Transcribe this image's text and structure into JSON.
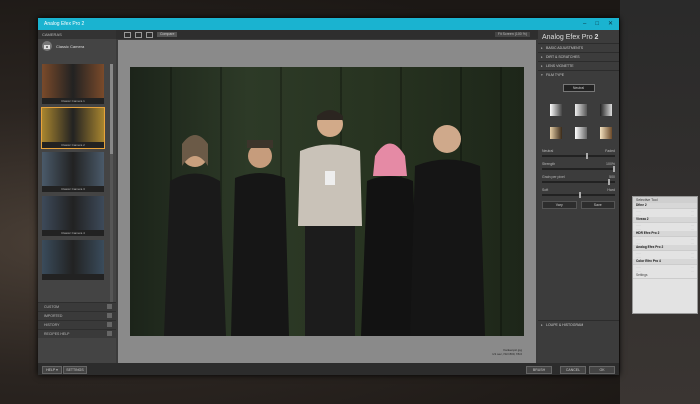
{
  "window": {
    "title": "Analog Efex Pro 2",
    "controls": [
      "–",
      "□",
      "✕"
    ]
  },
  "left_panel": {
    "header": "CAMERAS",
    "category": "Classic Camera",
    "thumbs": [
      {
        "caption": "Classic Camera 1",
        "tint": "#7a4a2a"
      },
      {
        "caption": "Classic Camera 2",
        "tint": "#a8852f"
      },
      {
        "caption": "Classic Camera 3",
        "tint": "#4a5a6a"
      },
      {
        "caption": "Classic Camera 4",
        "tint": "#3d4a5a"
      },
      {
        "caption": "",
        "tint": "#3a4c5c"
      }
    ],
    "sections": [
      "CUSTOM",
      "IMPORTED",
      "HISTORY",
      "RECIPES HELP"
    ]
  },
  "toolbar": {
    "compare": "Compare",
    "zoom": "Fit Screen (100 %)"
  },
  "canvas": {
    "caption_line1": "frankenpic.jpg",
    "caption_line2": "1/1 sec, ISO 800, f/8.0"
  },
  "right_panel": {
    "title_prefix": "Analog Efex Pro ",
    "title_num": "2",
    "sections": [
      "BASIC ADJUSTMENTS",
      "DIRT & SCRATCHES",
      "LENS VIGNETTE",
      "FILM TYPE"
    ],
    "preset": "Neutral",
    "slider_labels": {
      "neutral": "Neutral",
      "faded": "Faded",
      "strength": "Strength",
      "strength_val": "100%",
      "grain": "Grain per pixel",
      "grain_val": "500",
      "soft": "Soft",
      "hard": "Hard"
    },
    "buttons": [
      "Vary",
      "Save"
    ],
    "bottom_section": "LOUPE & HISTOGRAM"
  },
  "bottom_bar": {
    "help": "HELP ▾",
    "settings": "SETTINGS",
    "brush": "BRUSH",
    "cancel": "CANCEL",
    "ok": "OK"
  },
  "history": {
    "title": "Selective Tool",
    "rows": [
      {
        "t": "Dfine 2",
        "c": "b"
      },
      {
        "t": "Viveza 2",
        "c": "b"
      },
      {
        "t": "HDR Efex Pro 2",
        "c": "b"
      },
      {
        "t": "Analog Efex Pro 2",
        "c": "b"
      },
      {
        "t": "Color Efex Pro 4",
        "c": "b"
      },
      {
        "t": "Settings",
        "c": ""
      }
    ]
  },
  "colors": {
    "titlebar": "#1ab3d0",
    "selected_thumb": "#e8a33b"
  }
}
